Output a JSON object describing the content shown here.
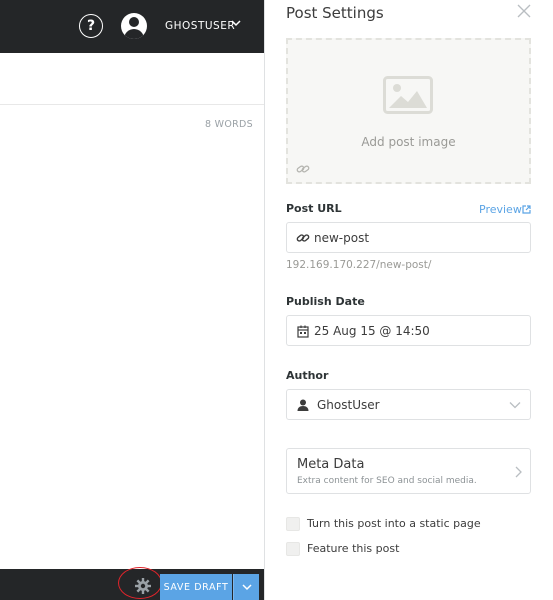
{
  "topbar": {
    "help_label": "?",
    "username": "GHOSTUSER"
  },
  "editor": {
    "word_count": "8 WORDS"
  },
  "footer": {
    "save_draft_label": "SAVE DRAFT"
  },
  "settings": {
    "title": "Post Settings",
    "image": {
      "label": "Add post image"
    },
    "post_url": {
      "label": "Post URL",
      "preview_label": "Preview",
      "value": "new-post",
      "hint": "192.169.170.227/new-post/"
    },
    "publish_date": {
      "label": "Publish Date",
      "value": "25 Aug 15 @ 14:50"
    },
    "author": {
      "label": "Author",
      "value": "GhostUser"
    },
    "meta_data": {
      "title": "Meta Data",
      "subtitle": "Extra content for SEO and social media."
    },
    "options": [
      {
        "label": "Turn this post into a static page",
        "checked": false
      },
      {
        "label": "Feature this post",
        "checked": false
      }
    ]
  },
  "colors": {
    "dark_bar": "#242628",
    "accent_blue": "#5ba4e5",
    "highlight_red": "#e0242b"
  },
  "icons": [
    "help-icon",
    "avatar-icon",
    "chevron-down-icon",
    "gear-icon",
    "close-icon",
    "image-icon",
    "link-icon",
    "external-link-icon",
    "calendar-icon",
    "user-icon",
    "chevron-right-icon"
  ]
}
